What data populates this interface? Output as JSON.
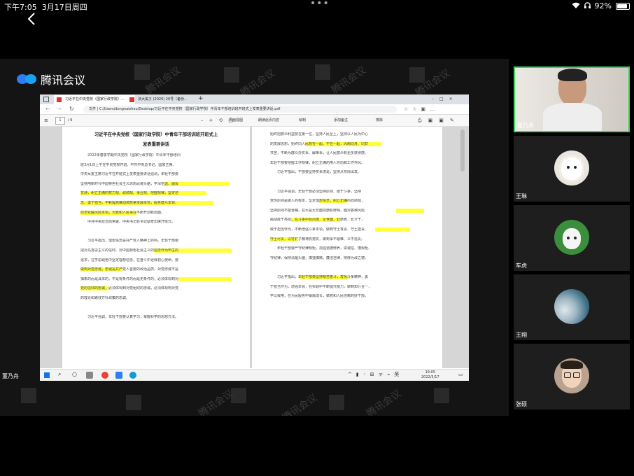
{
  "status_bar": {
    "time": "下午7:05",
    "date": "3月17日周四",
    "battery": "92%",
    "dots": "•••"
  },
  "app": {
    "name": "腾讯会议"
  },
  "shared_window": {
    "tabs": [
      {
        "label": "习近平在中央党校（国家行政学院）..."
      },
      {
        "label": "法大黑子 (2020) 20号（备份..."
      }
    ],
    "url": "文件  |  C:/Users/dongnaizhou/Desktop/习近平在中央党校（国家行政学院）中青年干部培训班开班式上发表重要讲话.pdf",
    "page_number": "1",
    "page_total": "/ 6",
    "toolbar": {
      "read_aloud": "朗读此页内容",
      "draw": "绘制",
      "highlight": "添加备注",
      "erase": "擦除",
      "page_view": "页面视图"
    },
    "doc": {
      "title_line1": "习近平在中央党校（国家行政学院）中青年干部培训班开班式上",
      "title_line2": "发表重要讲话",
      "left_lines": [
        "　　2022年春季学期中央党校（国家行政学院）中青年干部培训",
        "班3月1日上午在中央党校开班。中共中央总书记、国家主席、",
        "中央军委主席习近平在开班式上发表重要讲话强调，年轻干部要",
        "坚持用新时代中国特色社会主义思想武装头脑，学深悟透、融会",
        "贯通，树立正确的权力观、政绩观、事业观，把握规律，坚定信",
        "念，勇于担当，不断提高推动高质量发展本领，服务群众本领，",
        "防范化解风险本领，为党和人民事业不断开创新局面。",
        "　　中共中央政治局常委、中央书记处书记蔡奇出席开班式。",
        "",
        "　　习近平指出，理想信念是共产党人精神上的钙。年轻干部要",
        "把对马克思主义的信仰、对中国特色社会主义的信念作为毕生的",
        "追求，在学思践悟中坚定理想信念，在奋斗中诠释初心使命。要",
        "做到对党忠诚，忠诚是共产党人首要的政治品质，对党忠诚不是",
        "抽象的而是具体的，不是有条件的而是无条件的，必须体现到对",
        "党的信仰的忠诚，必须体现到对党组织的忠诚，必须体现到对党",
        "的理论和路线方针政策的忠诚。",
        "",
        "　　习近平强调，年轻干部要认真学习，掌握科学的思想方法。"
      ],
      "right_lines": [
        "始终把群众利益放在第一位，坚持人民至上，坚持以人民为中心",
        "的发展思想，始终同人民想在一起、干在一起，风雨同舟、同甘",
        "共苦，不断为群众办实事、解难事，让人民群众有更多获得感。",
        "年轻干部要把握工作规律，树立正确的用人导向和工作作风。",
        "　　习近平指出，干部要坚持实事求是，坚持从实际出发。",
        "",
        "　　习近平强调，年轻干部必须坚持原则、敢于斗争，坚持",
        "党性原则是做人的根本，坚定理想信念，树立正确的政绩观，",
        "坚持原则不能含糊，在大是大非面前旗帜鲜明，面对各种风险",
        "挑战敢于亮剑，在斗争中经风雨、见世面、壮筋骨、长才干，",
        "敢于担当作为，不断增强斗争本领，做到守土有责、守土担责、",
        "守土尽责，以钉钉子精神抓落实，做到事不避难、义不逃责。",
        "　　年轻干部要严守纪律规矩，加强道德修养，讲诚信、懂规矩、",
        "守纪律，保持清醒头脑，慎独慎微，廉洁自律，常修为政之德。",
        "",
        "　　习近平指出，年轻干部要坚持艰苦奋斗，发扬斗争精神，勇",
        "于担当作为，增强本领，在实践中不断提升能力，做到知行合一，",
        "学以致用，在为民服务中锻炼成长，做党和人民信赖的好干部。"
      ]
    },
    "taskbar": {
      "time": "19:05",
      "date": "2022/3/17"
    }
  },
  "main_speaker": {
    "name": "董乃舟"
  },
  "participants": [
    {
      "name": "董乃舟"
    },
    {
      "name": "王琳"
    },
    {
      "name": "车虎"
    },
    {
      "name": "王翔"
    },
    {
      "name": "张硕"
    }
  ],
  "colors": {
    "accent_green": "#3dd35c",
    "brand_blue": "#2d7df6",
    "highlight_yellow": "#ffff3a"
  }
}
